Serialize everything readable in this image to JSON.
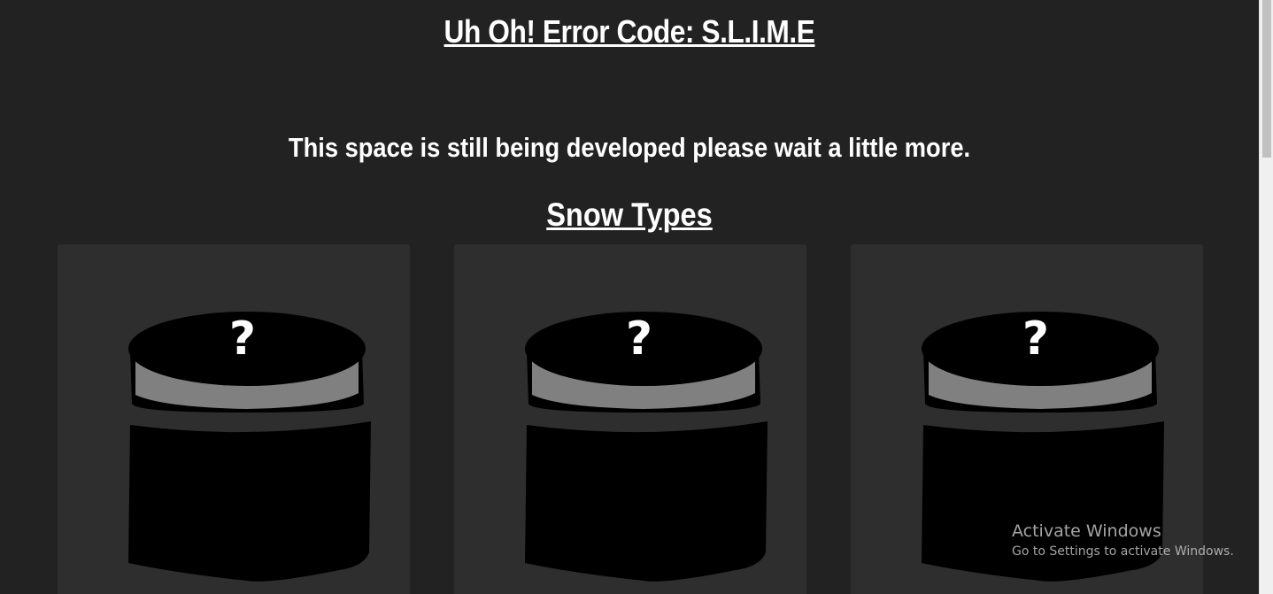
{
  "page": {
    "title": "Uh Oh! Error Code: S.L.I.M.E",
    "message": "This space is still being developed please wait a little more.",
    "section_title": "Snow Types"
  },
  "cards": [
    {
      "icon": "mystery-jar-icon",
      "glyph": "?"
    },
    {
      "icon": "mystery-jar-icon",
      "glyph": "?"
    },
    {
      "icon": "mystery-jar-icon",
      "glyph": "?"
    }
  ],
  "watermark": {
    "title": "Activate Windows",
    "subtitle": "Go to Settings to activate Windows."
  },
  "colors": {
    "background": "#222222",
    "card": "#2e2e2e",
    "text": "#ffffff",
    "jar_band": "#808080"
  }
}
